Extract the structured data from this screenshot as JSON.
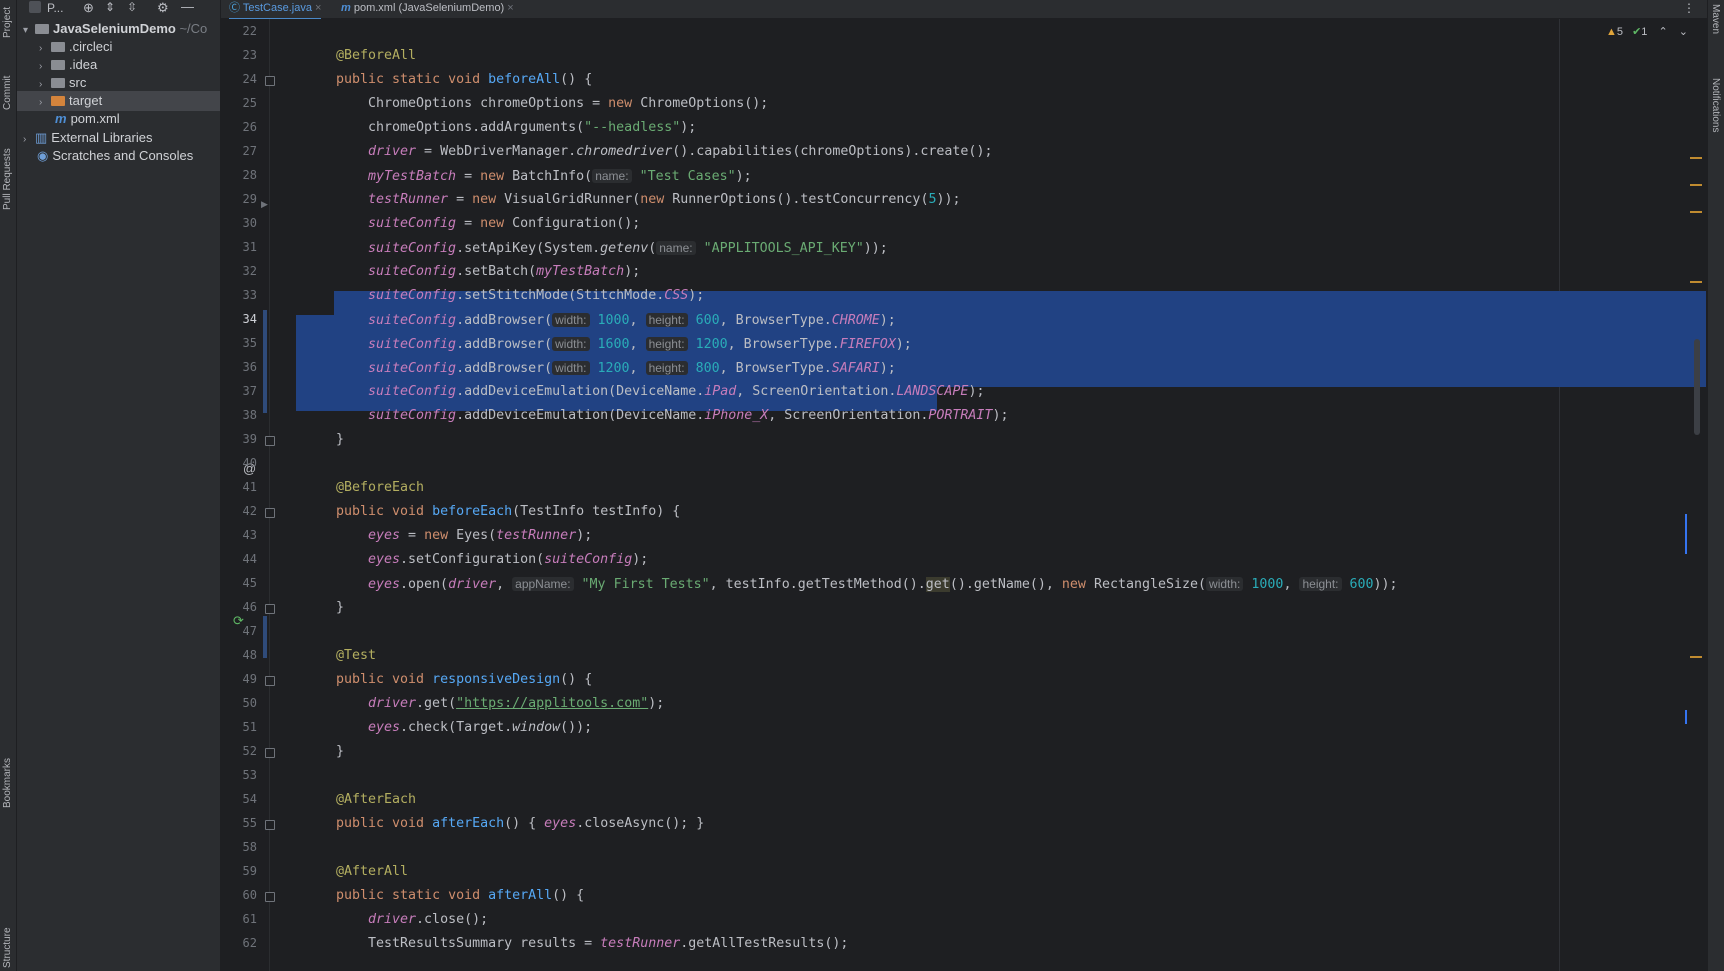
{
  "left_strip": {
    "project": "Project",
    "commit": "Commit",
    "pull_requests": "Pull Requests",
    "bookmarks": "Bookmarks",
    "structure": "Structure"
  },
  "right_strip": {
    "maven": "Maven",
    "notifications": "Notifications"
  },
  "project_panel": {
    "title": "P...",
    "root": "JavaSeleniumDemo",
    "root_path": "~/Co",
    "items": [
      {
        "label": ".circleci",
        "type": "folder"
      },
      {
        "label": ".idea",
        "type": "folder"
      },
      {
        "label": "src",
        "type": "folder"
      },
      {
        "label": "target",
        "type": "folder-orange"
      },
      {
        "label": "pom.xml",
        "type": "maven-file"
      },
      {
        "label": "External Libraries",
        "type": "library"
      },
      {
        "label": "Scratches and Consoles",
        "type": "scratches"
      }
    ]
  },
  "tabs": [
    {
      "label": "TestCase.java",
      "active": true
    },
    {
      "label": "pom.xml (JavaSeleniumDemo)",
      "active": false
    }
  ],
  "inspections": {
    "warnings": "5",
    "ok": "1"
  },
  "line_numbers": [
    "22",
    "23",
    "24",
    "25",
    "26",
    "27",
    "28",
    "29",
    "30",
    "31",
    "32",
    "33",
    "34",
    "35",
    "36",
    "37",
    "38",
    "39",
    "40",
    "41",
    "42",
    "43",
    "44",
    "45",
    "46",
    "47",
    "48",
    "49",
    "50",
    "51",
    "52",
    "53",
    "54",
    "55",
    "58",
    "59",
    "60",
    "61",
    "62"
  ],
  "code": {
    "l23": "@BeforeAll",
    "l24a": "public static void ",
    "l24b": "beforeAll",
    "l24c": "() {",
    "l25a": "ChromeOptions chromeOptions = ",
    "l25b": "new",
    "l25c": " ChromeOptions();",
    "l26a": "chromeOptions.addArguments(",
    "l26b": "\"--headless\"",
    "l26c": ");",
    "l27a": "driver",
    "l27b": " = WebDriverManager.",
    "l27c": "chromedriver",
    "l27d": "().capabilities(chromeOptions).create();",
    "l28a": "myTestBatch",
    "l28b": " = ",
    "l28c": "new",
    "l28d": " BatchInfo(",
    "l28h": "name:",
    "l28e": "\"Test Cases\"",
    "l28f": ");",
    "l29a": "testRunner",
    "l29b": " = ",
    "l29c": "new",
    "l29d": " VisualGridRunner(",
    "l29e": "new",
    "l29f": " RunnerOptions().testConcurrency(",
    "l29g": "5",
    "l29i": "));",
    "l30a": "suiteConfig",
    "l30b": " = ",
    "l30c": "new",
    "l30d": " Configuration();",
    "l31a": "suiteConfig",
    "l31b": ".setApiKey(System.",
    "l31c": "getenv",
    "l31d": "(",
    "l31h": "name:",
    "l31e": "\"APPLITOOLS_API_KEY\"",
    "l31f": "));",
    "l32a": "suiteConfig",
    "l32b": ".setBatch(",
    "l32c": "myTestBatch",
    "l32d": ");",
    "l33a": "suiteConfig",
    "l33b": ".setStitchMode(StitchMode.",
    "l33c": "CSS",
    "l33d": ");",
    "l34a": "suiteConfig",
    "l34b": ".addBrowser(",
    "l34w": "width:",
    "l34c": "1000",
    "l34h": "height:",
    "l34d": "600",
    "l34e": ", BrowserType.",
    "l34f": "CHROME",
    "l34g": ");",
    "l35a": "suiteConfig",
    "l35b": ".addBrowser(",
    "l35w": "width:",
    "l35c": "1600",
    "l35h": "height:",
    "l35d": "1200",
    "l35e": ", BrowserType.",
    "l35f": "FIREFOX",
    "l35g": ");",
    "l36a": "suiteConfig",
    "l36b": ".addBrowser(",
    "l36w": "width:",
    "l36c": "1200",
    "l36h": "height:",
    "l36d": "800",
    "l36e": ", BrowserType.",
    "l36f": "SAFARI",
    "l36g": ");",
    "l37a": "suiteConfig",
    "l37b": ".addDeviceEmulation(DeviceName.",
    "l37c": "iPad",
    "l37d": ", ScreenOrientation.",
    "l37e": "LANDSCAPE",
    "l37f": ");",
    "l38a": "suiteConfig",
    "l38b": ".addDeviceEmulation(DeviceName.",
    "l38c": "iPhone_X",
    "l38d": ", ScreenOrientation.",
    "l38e": "PORTRAIT",
    "l38f": ");",
    "l39": "}",
    "l41": "@BeforeEach",
    "l42a": "public void ",
    "l42b": "beforeEach",
    "l42c": "(TestInfo testInfo) {",
    "l43a": "eyes",
    "l43b": " = ",
    "l43c": "new",
    "l43d": " Eyes(",
    "l43e": "testRunner",
    "l43f": ");",
    "l44a": "eyes",
    "l44b": ".setConfiguration(",
    "l44c": "suiteConfig",
    "l44d": ");",
    "l45a": "eyes",
    "l45b": ".open(",
    "l45c": "driver",
    "l45d": ",",
    "l45h": "appName:",
    "l45e": "\"My First Tests\"",
    "l45f": ", testInfo.getTestMethod().",
    "l45g": "get",
    "l45i": "().getName(), ",
    "l45j": "new",
    "l45k": " RectangleSize(",
    "l45w": "width:",
    "l45l": "1000",
    "l45m": ",",
    "l45hh": "height:",
    "l45n": "600",
    "l45o": "));",
    "l46": "}",
    "l48": "@Test",
    "l49a": "public void ",
    "l49b": "responsiveDesign",
    "l49c": "() {",
    "l50a": "driver",
    "l50b": ".get(",
    "l50c": "\"https://applitools.com\"",
    "l50d": ");",
    "l51a": "eyes",
    "l51b": ".check(Target.",
    "l51c": "window",
    "l51d": "());",
    "l52": "}",
    "l54": "@AfterEach",
    "l55a": "public void ",
    "l55b": "afterEach",
    "l55c": "() { ",
    "l55d": "eyes",
    "l55e": ".closeAsync(); }",
    "l59": "@AfterAll",
    "l60a": "public static void ",
    "l60b": "afterAll",
    "l60c": "() {",
    "l61a": "driver",
    "l61b": ".close();",
    "l62a": "TestResultsSummary results = ",
    "l62b": "testRunner",
    "l62c": ".getAllTestResults();"
  }
}
